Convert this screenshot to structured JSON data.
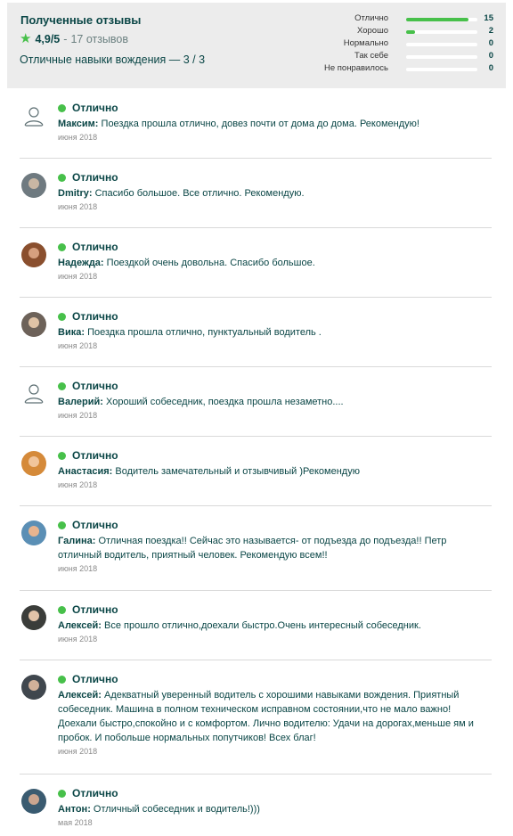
{
  "summary": {
    "title": "Полученные отзывы",
    "rating_score": "4,9/5",
    "rating_sep": "-",
    "rating_count": "17 отзывов",
    "skills": "Отличные навыки вождения — 3 / 3",
    "accent_color": "#47c04a"
  },
  "breakdown": [
    {
      "label": "Отлично",
      "count": "15",
      "fraction": 0.88
    },
    {
      "label": "Хорошо",
      "count": "2",
      "fraction": 0.12
    },
    {
      "label": "Нормально",
      "count": "0",
      "fraction": 0
    },
    {
      "label": "Так себе",
      "count": "0",
      "fraction": 0
    },
    {
      "label": "Не понравилось",
      "count": "0",
      "fraction": 0
    }
  ],
  "reviews": [
    {
      "status": "Отлично",
      "author": "Максим:",
      "text": "Поездка прошла отлично, довез почти от дома до дома. Рекомендую!",
      "date": "июня 2018",
      "avatar": "placeholder"
    },
    {
      "status": "Отлично",
      "author": "Dmitry:",
      "text": "Спасибо большое. Все отлично. Рекомендую.",
      "date": "июня 2018",
      "avatar": "photo"
    },
    {
      "status": "Отлично",
      "author": "Надежда:",
      "text": "Поездкой очень довольна. Спасибо большое.",
      "date": "июня 2018",
      "avatar": "photo"
    },
    {
      "status": "Отлично",
      "author": "Вика:",
      "text": "Поездка прошла отлично, пунктуальный водитель .",
      "date": "июня 2018",
      "avatar": "photo"
    },
    {
      "status": "Отлично",
      "author": "Валерий:",
      "text": "Хороший собеседник, поездка прошла незаметно....",
      "date": "июня 2018",
      "avatar": "placeholder"
    },
    {
      "status": "Отлично",
      "author": "Анастасия:",
      "text": "Водитель замечательный и отзывчивый )Рекомендую",
      "date": "июня 2018",
      "avatar": "photo"
    },
    {
      "status": "Отлично",
      "author": "Галина:",
      "text": "Отличная поездка!! Сейчас это называется- от подъезда до подъезда!! Петр отличный водитель, приятный человек. Рекомендую всем!!",
      "date": "июня 2018",
      "avatar": "photo"
    },
    {
      "status": "Отлично",
      "author": "Алексей:",
      "text": "Все прошло отлично,доехали быстро.Очень интересный собеседник.",
      "date": "июня 2018",
      "avatar": "photo"
    },
    {
      "status": "Отлично",
      "author": "Алексей:",
      "text": "Адекватный уверенный водитель с хорошими навыками вождения. Приятный собеседник. Машина в полном техническом исправном состоянии,что не мало важно! Доехали быстро,спокойно и с комфортом. Лично водителю: Удачи на дорогах,меньше ям и пробок. И побольше нормальных попутчиков! Всех благ!",
      "date": "июня 2018",
      "avatar": "photo"
    },
    {
      "status": "Отлично",
      "author": "Антон:",
      "text": "Отличный собеседник и водитель!)))",
      "date": "мая 2018",
      "avatar": "photo"
    }
  ]
}
